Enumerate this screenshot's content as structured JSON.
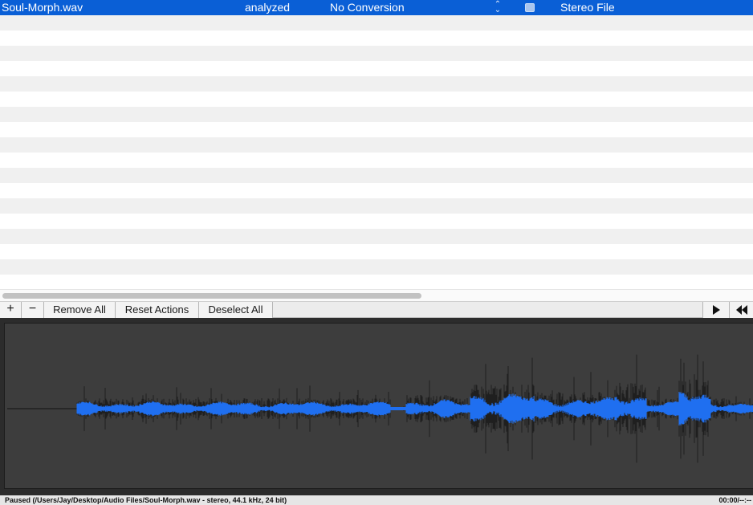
{
  "file_list": {
    "rows": [
      {
        "name": "Soul-Morph.wav",
        "status": "analyzed",
        "conversion": "No Conversion",
        "type": "Stereo File",
        "selected": true
      }
    ],
    "empty_row_count": 18
  },
  "toolbar": {
    "add_label": "+",
    "remove_label": "−",
    "remove_all_label": "Remove All",
    "reset_actions_label": "Reset Actions",
    "deselect_all_label": "Deselect All",
    "play_icon": "play-icon",
    "rewind_icon": "rewind-icon"
  },
  "waveform": {
    "back_color": "#1f1f1f",
    "front_color": "#1f6ff0",
    "background_color": "#3d3d3d"
  },
  "status": {
    "text": "Paused (/Users/Jay/Desktop/Audio Files/Soul-Morph.wav - stereo, 44.1 kHz, 24 bit)",
    "time": "00:00/--:--"
  },
  "colors": {
    "selection": "#0a5fd6",
    "row_alt": "#f0f0f0"
  }
}
